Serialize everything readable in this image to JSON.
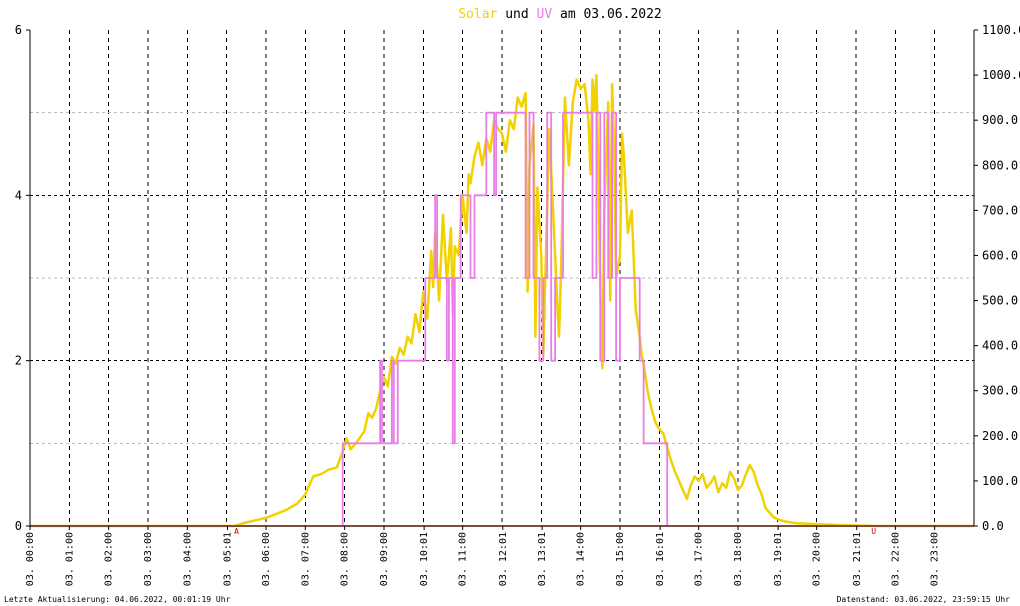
{
  "chart_data": {
    "type": "line",
    "title": {
      "solar_word": "Solar",
      "and_word": "und",
      "uv_word": "UV",
      "date_text": "am 03.06.2022"
    },
    "colors": {
      "solar": "#f2d100",
      "uv": "#e87de8",
      "overlap": "#f39a7c",
      "marker": "#c00000",
      "title_solar": "#f2d100",
      "title_uv": "#e87de8"
    },
    "y_left": {
      "range": [
        0,
        6
      ],
      "ticks": [
        "0",
        "2",
        "4",
        "6"
      ],
      "major": [
        0,
        2,
        4,
        6
      ],
      "minor": [
        1,
        3,
        5
      ]
    },
    "y_right": {
      "range": [
        0,
        1100
      ],
      "ticks": [
        "0.0",
        "100.0",
        "200.0",
        "300.0",
        "400.0",
        "500.0",
        "600.0",
        "700.0",
        "800.0",
        "900.0",
        "1000.0",
        "1100.0"
      ]
    },
    "x_axis": {
      "range_hours": [
        0,
        24
      ],
      "labels": [
        {
          "h": 0,
          "t": "03. 00:00"
        },
        {
          "h": 1,
          "t": "03. 01:00"
        },
        {
          "h": 2,
          "t": "03. 02:00"
        },
        {
          "h": 3,
          "t": "03. 03:00"
        },
        {
          "h": 4,
          "t": "03. 04:00"
        },
        {
          "h": 5.02,
          "t": "03. 05:01"
        },
        {
          "h": 6,
          "t": "03. 06:00"
        },
        {
          "h": 7,
          "t": "03. 07:00"
        },
        {
          "h": 8,
          "t": "03. 08:00"
        },
        {
          "h": 9,
          "t": "03. 09:00"
        },
        {
          "h": 10.02,
          "t": "03. 10:01"
        },
        {
          "h": 11,
          "t": "03. 11:00"
        },
        {
          "h": 12.02,
          "t": "03. 12:01"
        },
        {
          "h": 13.02,
          "t": "03. 13:01"
        },
        {
          "h": 14,
          "t": "03. 14:00"
        },
        {
          "h": 15,
          "t": "03. 15:00"
        },
        {
          "h": 16.02,
          "t": "03. 16:01"
        },
        {
          "h": 17,
          "t": "03. 17:00"
        },
        {
          "h": 18,
          "t": "03. 18:00"
        },
        {
          "h": 19.02,
          "t": "03. 19:01"
        },
        {
          "h": 20,
          "t": "03. 20:00"
        },
        {
          "h": 21.02,
          "t": "03. 21:01"
        },
        {
          "h": 22,
          "t": "03. 22:00"
        },
        {
          "h": 23,
          "t": "03. 23:00"
        }
      ]
    },
    "markers": [
      {
        "h": 5.25,
        "label": "A"
      },
      {
        "h": 21.45,
        "label": "U"
      }
    ],
    "series": [
      {
        "key": "solar",
        "axis": "right",
        "points": [
          [
            0,
            0
          ],
          [
            5.2,
            0
          ],
          [
            5.5,
            8
          ],
          [
            6,
            18
          ],
          [
            6.5,
            35
          ],
          [
            6.8,
            50
          ],
          [
            7,
            70
          ],
          [
            7.2,
            110
          ],
          [
            7.4,
            115
          ],
          [
            7.6,
            125
          ],
          [
            7.8,
            130
          ],
          [
            7.95,
            165
          ],
          [
            8.05,
            195
          ],
          [
            8.15,
            170
          ],
          [
            8.3,
            185
          ],
          [
            8.5,
            210
          ],
          [
            8.6,
            250
          ],
          [
            8.7,
            240
          ],
          [
            8.8,
            260
          ],
          [
            8.9,
            300
          ],
          [
            9,
            330
          ],
          [
            9.1,
            310
          ],
          [
            9.2,
            375
          ],
          [
            9.3,
            360
          ],
          [
            9.4,
            395
          ],
          [
            9.5,
            380
          ],
          [
            9.6,
            420
          ],
          [
            9.7,
            405
          ],
          [
            9.8,
            470
          ],
          [
            9.9,
            430
          ],
          [
            10,
            520
          ],
          [
            10.1,
            460
          ],
          [
            10.2,
            610
          ],
          [
            10.25,
            530
          ],
          [
            10.3,
            650
          ],
          [
            10.4,
            500
          ],
          [
            10.5,
            690
          ],
          [
            10.6,
            540
          ],
          [
            10.7,
            660
          ],
          [
            10.75,
            470
          ],
          [
            10.8,
            620
          ],
          [
            10.9,
            600
          ],
          [
            11,
            730
          ],
          [
            11.1,
            650
          ],
          [
            11.15,
            780
          ],
          [
            11.2,
            760
          ],
          [
            11.3,
            820
          ],
          [
            11.4,
            850
          ],
          [
            11.5,
            800
          ],
          [
            11.6,
            860
          ],
          [
            11.7,
            830
          ],
          [
            11.8,
            900
          ],
          [
            11.9,
            880
          ],
          [
            12,
            870
          ],
          [
            12.1,
            830
          ],
          [
            12.2,
            900
          ],
          [
            12.3,
            880
          ],
          [
            12.4,
            950
          ],
          [
            12.5,
            930
          ],
          [
            12.6,
            960
          ],
          [
            12.65,
            520
          ],
          [
            12.7,
            800
          ],
          [
            12.8,
            890
          ],
          [
            12.85,
            420
          ],
          [
            12.9,
            750
          ],
          [
            13,
            600
          ],
          [
            13.05,
            380
          ],
          [
            13.1,
            550
          ],
          [
            13.2,
            880
          ],
          [
            13.3,
            700
          ],
          [
            13.4,
            500
          ],
          [
            13.45,
            420
          ],
          [
            13.5,
            560
          ],
          [
            13.6,
            950
          ],
          [
            13.7,
            800
          ],
          [
            13.8,
            940
          ],
          [
            13.9,
            990
          ],
          [
            14,
            970
          ],
          [
            14.1,
            980
          ],
          [
            14.2,
            900
          ],
          [
            14.25,
            780
          ],
          [
            14.3,
            990
          ],
          [
            14.35,
            920
          ],
          [
            14.4,
            1000
          ],
          [
            14.45,
            780
          ],
          [
            14.5,
            520
          ],
          [
            14.55,
            350
          ],
          [
            14.6,
            700
          ],
          [
            14.7,
            940
          ],
          [
            14.75,
            500
          ],
          [
            14.8,
            980
          ],
          [
            14.85,
            850
          ],
          [
            14.9,
            550
          ],
          [
            15,
            600
          ],
          [
            15.05,
            870
          ],
          [
            15.1,
            820
          ],
          [
            15.2,
            650
          ],
          [
            15.3,
            700
          ],
          [
            15.4,
            480
          ],
          [
            15.5,
            420
          ],
          [
            15.55,
            380
          ],
          [
            15.6,
            360
          ],
          [
            15.7,
            300
          ],
          [
            15.8,
            260
          ],
          [
            15.9,
            230
          ],
          [
            16,
            215
          ],
          [
            16.1,
            205
          ],
          [
            16.2,
            175
          ],
          [
            16.3,
            145
          ],
          [
            16.4,
            120
          ],
          [
            16.5,
            100
          ],
          [
            16.6,
            80
          ],
          [
            16.7,
            60
          ],
          [
            16.8,
            90
          ],
          [
            16.9,
            110
          ],
          [
            17,
            100
          ],
          [
            17.1,
            115
          ],
          [
            17.2,
            85
          ],
          [
            17.3,
            95
          ],
          [
            17.4,
            110
          ],
          [
            17.5,
            75
          ],
          [
            17.6,
            95
          ],
          [
            17.7,
            85
          ],
          [
            17.8,
            120
          ],
          [
            17.9,
            105
          ],
          [
            18,
            80
          ],
          [
            18.1,
            90
          ],
          [
            18.2,
            115
          ],
          [
            18.3,
            135
          ],
          [
            18.4,
            120
          ],
          [
            18.5,
            90
          ],
          [
            18.6,
            70
          ],
          [
            18.7,
            40
          ],
          [
            18.8,
            30
          ],
          [
            18.9,
            20
          ],
          [
            19,
            15
          ],
          [
            19.2,
            10
          ],
          [
            19.5,
            6
          ],
          [
            19.8,
            5
          ],
          [
            20,
            4
          ],
          [
            20.3,
            3
          ],
          [
            20.6,
            2
          ],
          [
            21,
            1
          ],
          [
            21.5,
            0
          ],
          [
            24,
            0
          ]
        ]
      },
      {
        "key": "uv",
        "axis": "left",
        "points": [
          [
            0,
            0
          ],
          [
            7.95,
            0
          ],
          [
            7.95,
            1
          ],
          [
            8.9,
            1
          ],
          [
            8.9,
            2
          ],
          [
            8.95,
            2
          ],
          [
            8.95,
            1
          ],
          [
            9.2,
            1
          ],
          [
            9.2,
            2
          ],
          [
            9.25,
            2
          ],
          [
            9.25,
            1
          ],
          [
            9.35,
            1
          ],
          [
            9.35,
            2
          ],
          [
            10.05,
            2
          ],
          [
            10.05,
            3
          ],
          [
            10.3,
            3
          ],
          [
            10.3,
            4
          ],
          [
            10.35,
            4
          ],
          [
            10.35,
            3
          ],
          [
            10.6,
            3
          ],
          [
            10.6,
            2
          ],
          [
            10.65,
            2
          ],
          [
            10.65,
            3
          ],
          [
            10.75,
            3
          ],
          [
            10.75,
            1
          ],
          [
            10.8,
            1
          ],
          [
            10.8,
            3
          ],
          [
            10.95,
            3
          ],
          [
            10.95,
            4
          ],
          [
            11.2,
            4
          ],
          [
            11.2,
            3
          ],
          [
            11.3,
            3
          ],
          [
            11.3,
            4
          ],
          [
            11.6,
            4
          ],
          [
            11.6,
            5
          ],
          [
            11.8,
            5
          ],
          [
            11.8,
            4
          ],
          [
            11.85,
            4
          ],
          [
            11.85,
            5
          ],
          [
            12.2,
            5
          ],
          [
            12.2,
            5
          ],
          [
            12.6,
            5
          ],
          [
            12.6,
            3
          ],
          [
            12.7,
            3
          ],
          [
            12.7,
            5
          ],
          [
            12.8,
            5
          ],
          [
            12.8,
            3
          ],
          [
            12.95,
            3
          ],
          [
            12.95,
            2
          ],
          [
            13.05,
            2
          ],
          [
            13.05,
            3
          ],
          [
            13.15,
            3
          ],
          [
            13.15,
            5
          ],
          [
            13.25,
            5
          ],
          [
            13.25,
            2
          ],
          [
            13.35,
            2
          ],
          [
            13.35,
            3
          ],
          [
            13.55,
            3
          ],
          [
            13.55,
            5
          ],
          [
            14.3,
            5
          ],
          [
            14.3,
            3
          ],
          [
            14.4,
            3
          ],
          [
            14.4,
            5
          ],
          [
            14.5,
            5
          ],
          [
            14.5,
            2
          ],
          [
            14.6,
            2
          ],
          [
            14.6,
            5
          ],
          [
            14.7,
            5
          ],
          [
            14.7,
            3
          ],
          [
            14.8,
            3
          ],
          [
            14.8,
            5
          ],
          [
            14.9,
            5
          ],
          [
            14.9,
            2
          ],
          [
            15,
            2
          ],
          [
            15,
            3
          ],
          [
            15.5,
            3
          ],
          [
            15.5,
            2
          ],
          [
            15.6,
            2
          ],
          [
            15.6,
            1
          ],
          [
            16.2,
            1
          ],
          [
            16.2,
            0
          ],
          [
            24,
            0
          ]
        ]
      }
    ]
  },
  "footer": {
    "last_update": "Letzte Aktualisierung: 04.06.2022, 00:01:19 Uhr",
    "data_state": "Datenstand: 03.06.2022, 23:59:15 Uhr"
  }
}
